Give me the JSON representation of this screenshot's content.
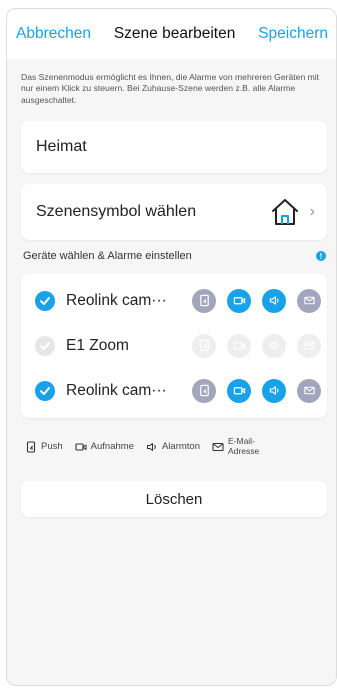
{
  "header": {
    "cancel": "Abbrechen",
    "title": "Szene bearbeiten",
    "save": "Speichern"
  },
  "description": "Das Szenenmodus ermöglicht es Ihnen, die Alarme von mehreren Geräten mit nur einem Klick zu steuern. Bei Zuhause-Szene werden z.B. alle Alarme ausgeschaltet.",
  "scene_name": "Heimat",
  "scene_icon": {
    "label": "Szenensymbol wählen",
    "icon": "house-icon",
    "chevron": "›"
  },
  "devices_section": {
    "title": "Geräte wählen & Alarme einstellen",
    "info_icon": "!"
  },
  "devices": [
    {
      "name": "Reolink cam···",
      "selected": true,
      "enabled": true,
      "alarms": {
        "push": false,
        "record": true,
        "siren": true,
        "email": false
      }
    },
    {
      "name": "E1 Zoom",
      "selected": false,
      "enabled": false,
      "alarms": {
        "push": false,
        "record": false,
        "siren": false,
        "email": false
      }
    },
    {
      "name": "Reolink cam···",
      "selected": true,
      "enabled": true,
      "alarms": {
        "push": false,
        "record": true,
        "siren": true,
        "email": false
      }
    }
  ],
  "legend": {
    "push": "Push",
    "record": "Aufnahme",
    "siren": "Alarmton",
    "email": "E-Mail-Adresse"
  },
  "delete_label": "Löschen",
  "colors": {
    "accent": "#1aa2e8",
    "inactive_icon": "#a2a6bd",
    "disabled_icon": "#eeeeef"
  }
}
